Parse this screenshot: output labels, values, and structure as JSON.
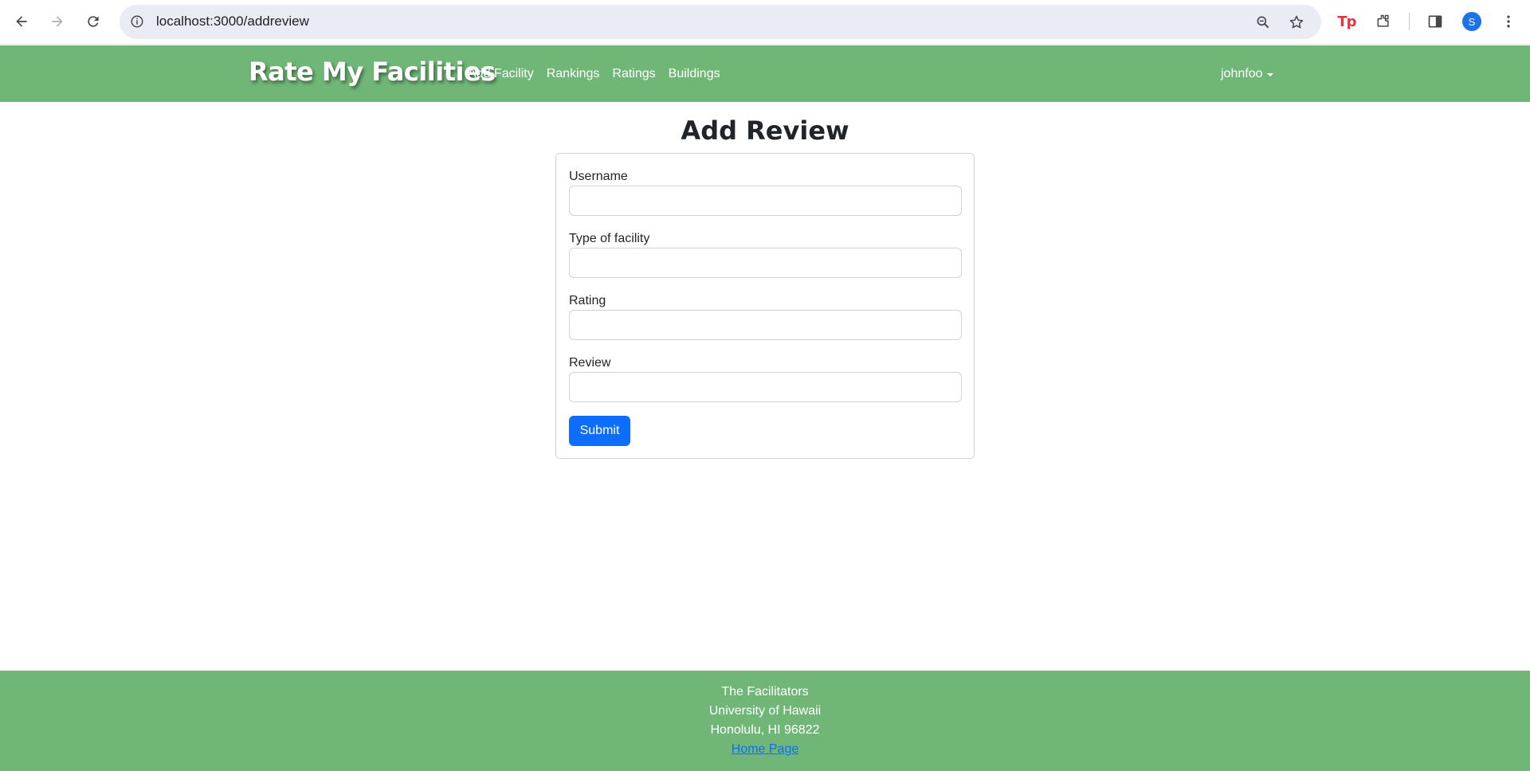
{
  "browser": {
    "url": "localhost:3000/addreview",
    "profile_initial": "S",
    "extension_label": "Tp"
  },
  "navbar": {
    "brand": "Rate My Facilities",
    "links": [
      "Add Facility",
      "Rankings",
      "Ratings",
      "Buildings"
    ],
    "user": "johnfoo"
  },
  "form": {
    "title": "Add Review",
    "fields": [
      {
        "label": "Username",
        "value": ""
      },
      {
        "label": "Type of facility",
        "value": ""
      },
      {
        "label": "Rating",
        "value": ""
      },
      {
        "label": "Review",
        "value": ""
      }
    ],
    "submit_label": "Submit"
  },
  "footer": {
    "line1": "The Facilitators",
    "line2": "University of Hawaii",
    "line3": "Honolulu, HI 96822",
    "link": "Home Page"
  },
  "colors": {
    "nav_green": "#70b777",
    "primary_blue": "#0d6efd"
  }
}
